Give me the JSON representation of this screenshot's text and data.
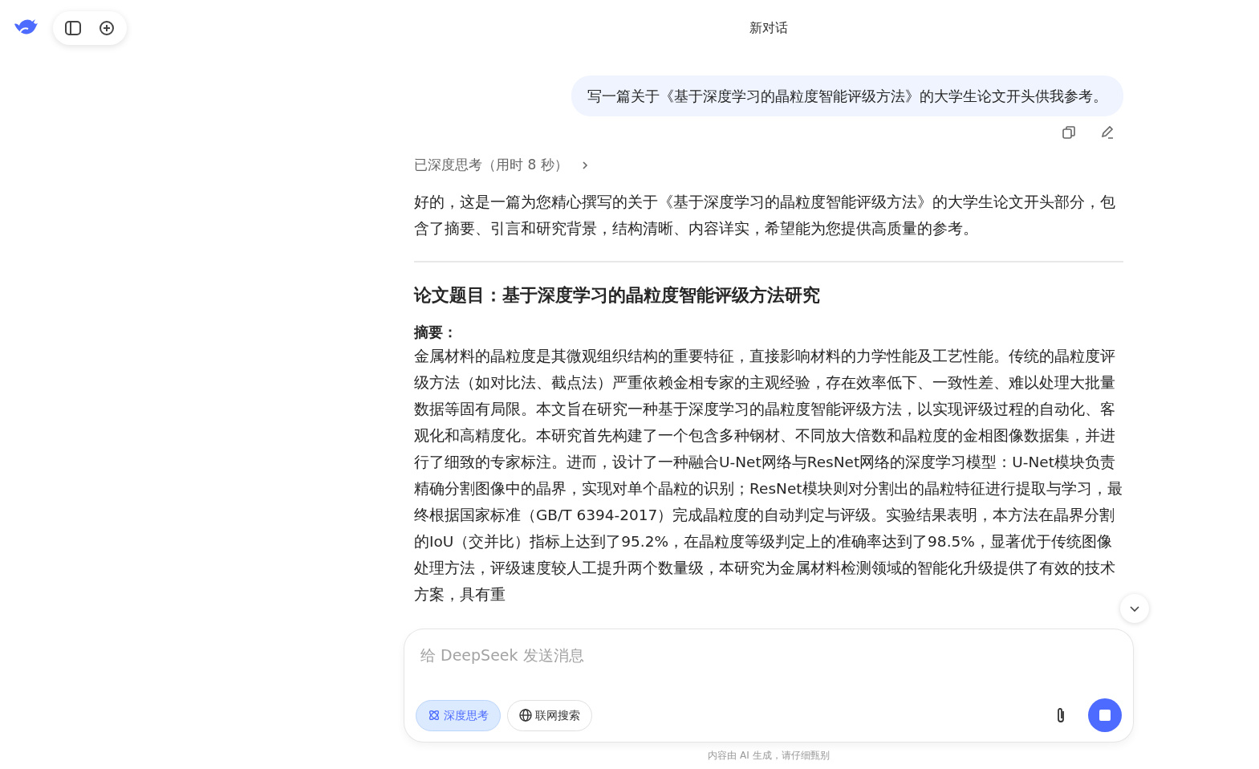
{
  "header": {
    "title": "新对话"
  },
  "user_message": {
    "text": "写一篇关于《基于深度学习的晶粒度智能评级方法》的大学生论文开头供我参考。"
  },
  "thinking": {
    "label": "已深度思考（用时 8 秒）",
    "expanded": false
  },
  "reply": {
    "intro": "好的，这是一篇为您精心撰写的关于《基于深度学习的晶粒度智能评级方法》的大学生论文开头部分，包含了摘要、引言和研究背景，结构清晰、内容详实，希望能为您提供高质量的参考。",
    "title": "论文题目：基于深度学习的晶粒度智能评级方法研究",
    "sections": [
      {
        "heading": "摘要：",
        "text": "金属材料的晶粒度是其微观组织结构的重要特征，直接影响材料的力学性能及工艺性能。传统的晶粒度评级方法（如对比法、截点法）严重依赖金相专家的主观经验，存在效率低下、一致性差、难以处理大批量数据等固有局限。本文旨在研究一种基于深度学习的晶粒度智能评级方法，以实现评级过程的自动化、客观化和高精度化。本研究首先构建了一个包含多种钢材、不同放大倍数和晶粒度的金相图像数据集，并进行了细致的专家标注。进而，设计了一种融合U-Net网络与ResNet网络的深度学习模型：U-Net模块负责精确分割图像中的晶界，实现对单个晶粒的识别；ResNet模块则对分割出的晶粒特征进行提取与学习，最终根据国家标准（GB/T 6394-2017）完成晶粒度的自动判定与评级。实验结果表明，本方法在晶界分割的IoU（交并比）指标上达到了95.2%，在晶粒度等级判定上的准确率达到了98.5%，显著优于传统图像处理方法，评级速度较人工提升两个数量级，本研究为金属材料检测领域的智能化升级提供了有效的技术方案，具有重"
      }
    ]
  },
  "composer": {
    "placeholder": "给 DeepSeek 发送消息",
    "toggles": [
      {
        "label": "深度思考",
        "selected": true
      },
      {
        "label": "联网搜索",
        "selected": false
      }
    ]
  },
  "disclaimer": "内容由 AI 生成，请仔细甄别"
}
